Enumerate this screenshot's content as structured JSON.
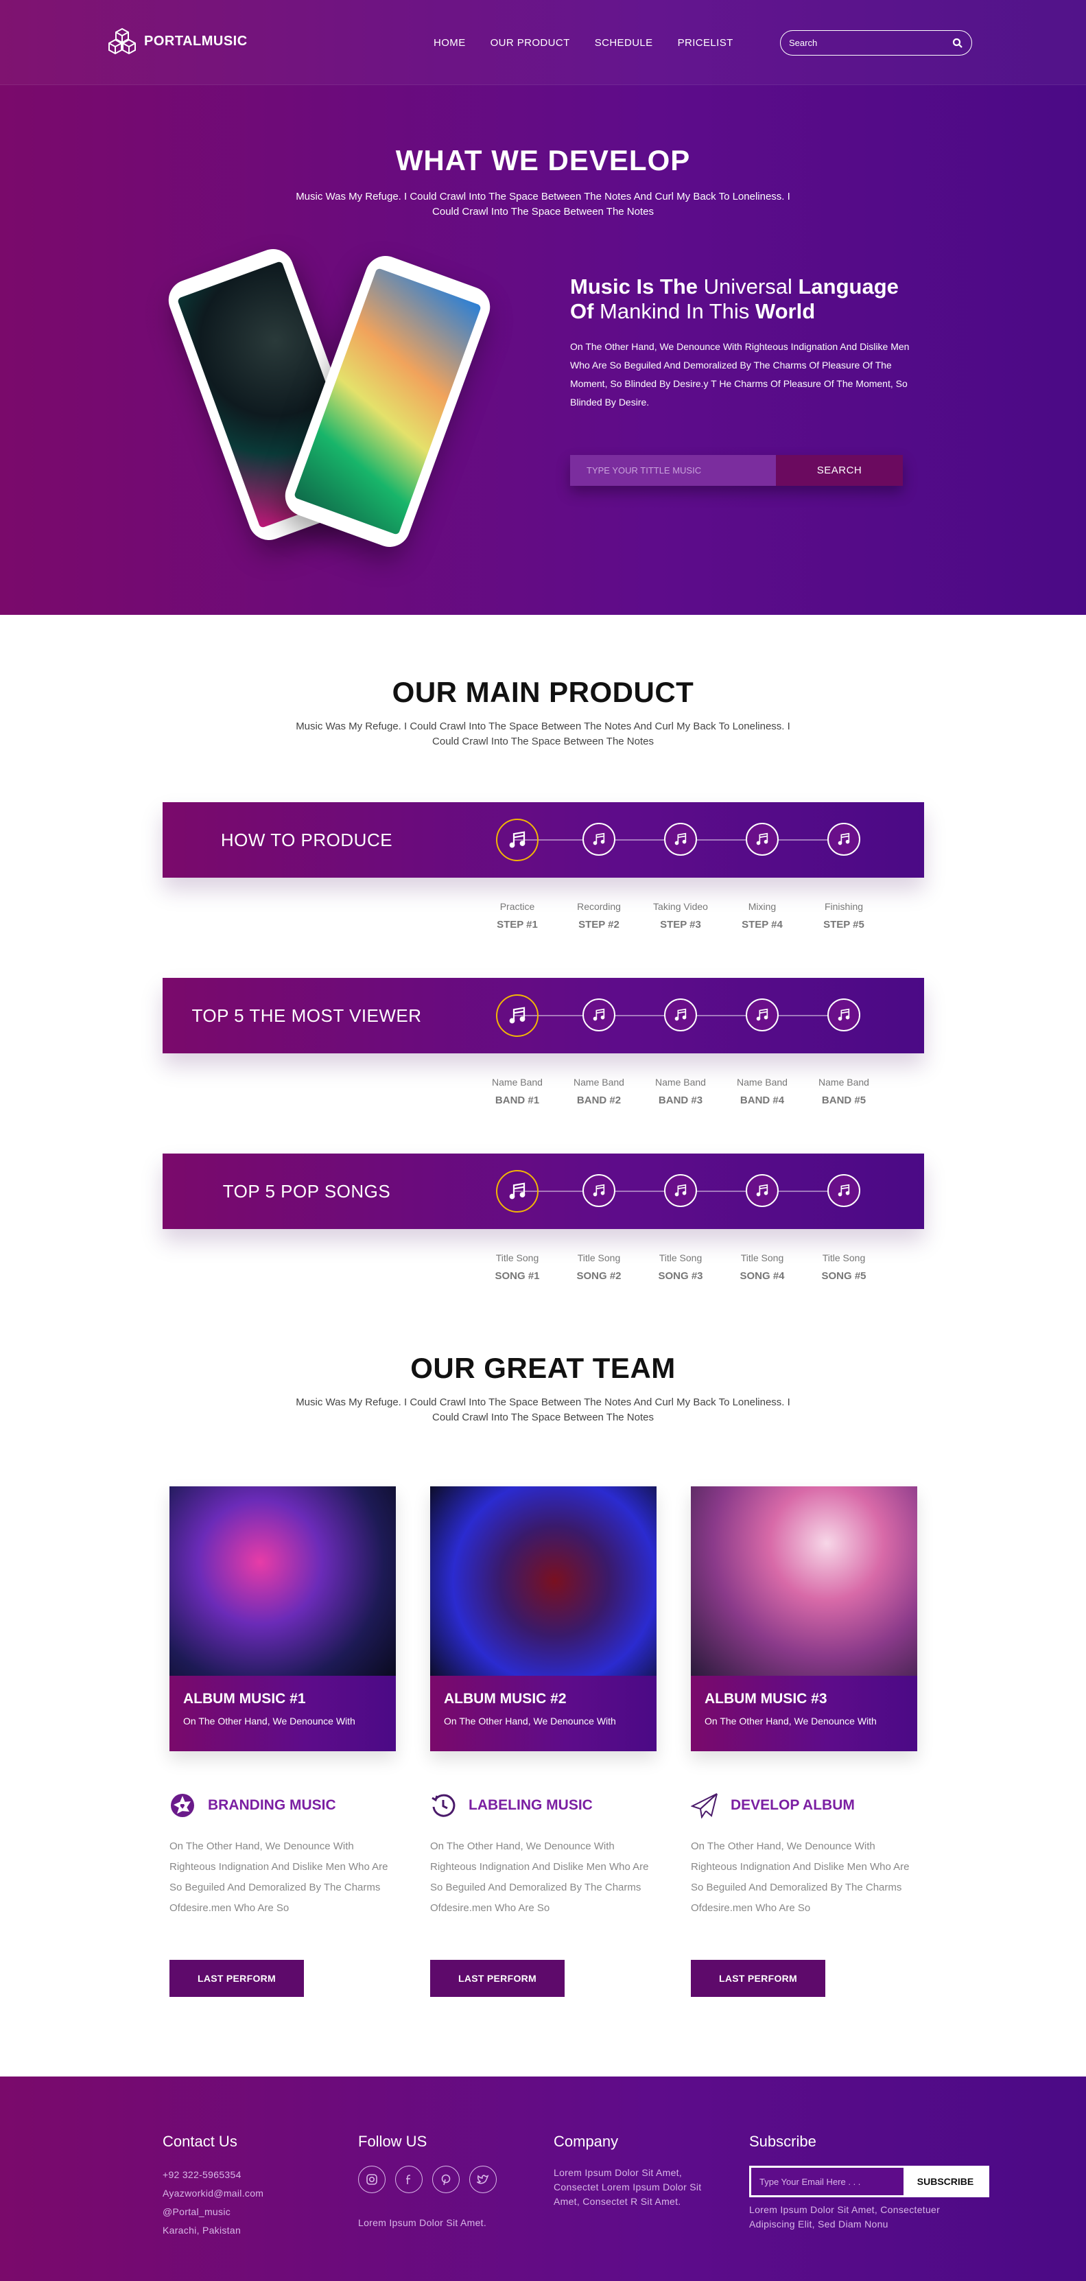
{
  "brand": {
    "name": "PORTALMUSIC"
  },
  "nav": [
    "HOME",
    "OUR PRODUCT",
    "SCHEDULE",
    "PRICELIST"
  ],
  "search": {
    "placeholder": "Search"
  },
  "hero": {
    "title": "WHAT WE DEVELOP",
    "subtitle": "Music Was My Refuge. I Could Crawl Into The Space Between The Notes And Curl My Back To Loneliness. I Could Crawl Into The Space Between The Notes",
    "headline_1": "Music Is The",
    "headline_2": " Universal ",
    "headline_3": "Language Of",
    "headline_4": " Mankind In This ",
    "headline_5": "World",
    "paragraph": "On The Other Hand, We Denounce With Righteous Indignation And Dislike Men Who Are So Beguiled And Demoralized By The Charms Of Pleasure Of The Moment, So Blinded By Desire.y T He Charms Of Pleasure Of The Moment, So Blinded By Desire.",
    "input_placeholder": "TYPE YOUR TITTLE MUSIC",
    "search_button": "SEARCH"
  },
  "product": {
    "title": "OUR MAIN PRODUCT",
    "subtitle": "Music Was My Refuge. I Could Crawl Into The Space Between The Notes And Curl My Back To Loneliness. I Could Crawl Into The Space Between The Notes",
    "rows": [
      {
        "label": "HOW TO PRODUCE",
        "steps": [
          {
            "a": "Practice",
            "b": "STEP #1"
          },
          {
            "a": "Recording",
            "b": "STEP #2"
          },
          {
            "a": "Taking Video",
            "b": "STEP #3"
          },
          {
            "a": "Mixing",
            "b": "STEP #4"
          },
          {
            "a": "Finishing",
            "b": "STEP #5"
          }
        ]
      },
      {
        "label": "TOP 5 THE MOST VIEWER",
        "steps": [
          {
            "a": "Name Band",
            "b": "BAND #1"
          },
          {
            "a": "Name Band",
            "b": "BAND #2"
          },
          {
            "a": "Name Band",
            "b": "BAND #3"
          },
          {
            "a": "Name Band",
            "b": "BAND #4"
          },
          {
            "a": "Name Band",
            "b": "BAND #5"
          }
        ]
      },
      {
        "label": "TOP 5 POP SONGS",
        "steps": [
          {
            "a": "Title Song",
            "b": "SONG #1"
          },
          {
            "a": "Title Song",
            "b": "SONG #2"
          },
          {
            "a": "Title Song",
            "b": "SONG #3"
          },
          {
            "a": "Title Song",
            "b": "SONG #4"
          },
          {
            "a": "Title Song",
            "b": "SONG #5"
          }
        ]
      }
    ]
  },
  "team": {
    "title": "OUR GREAT TEAM",
    "subtitle": "Music Was My Refuge. I Could Crawl Into The Space Between The Notes And Curl My Back To Loneliness. I Could Crawl Into The Space Between The Notes",
    "cards": [
      {
        "title": "ALBUM MUSIC #1",
        "text": "On The Other Hand, We Denounce With"
      },
      {
        "title": "ALBUM MUSIC #2",
        "text": "On The Other Hand, We Denounce With"
      },
      {
        "title": "ALBUM MUSIC #3",
        "text": "On The Other Hand, We Denounce With"
      }
    ],
    "features": [
      {
        "title": "BRANDING MUSIC",
        "icon": "aperture-icon",
        "text": "On The Other Hand, We Denounce With Righteous Indignation And Dislike Men Who Are So Beguiled And Demoralized By The Charms Ofdesire.men Who Are So",
        "button": "LAST PERFORM"
      },
      {
        "title": "LABELING MUSIC",
        "icon": "history-icon",
        "text": "On The Other Hand, We Denounce With Righteous Indignation And Dislike Men Who Are So Beguiled And Demoralized By The Charms Ofdesire.men Who Are So",
        "button": "LAST PERFORM"
      },
      {
        "title": "DEVELOP ALBUM",
        "icon": "paper-plane-icon",
        "text": "On The Other Hand, We Denounce With Righteous Indignation And Dislike Men Who Are So Beguiled And Demoralized By The Charms Ofdesire.men Who Are So",
        "button": "LAST PERFORM"
      }
    ]
  },
  "footer": {
    "contact": {
      "title": "Contact Us",
      "phone": "+92 322-5965354",
      "email": "Ayazworkid@mail.com",
      "handle": "@Portal_music",
      "city": "Karachi, Pakistan"
    },
    "follow": {
      "title": "Follow US",
      "text": "Lorem Ipsum Dolor Sit Amet."
    },
    "company": {
      "title": "Company",
      "text": "Lorem Ipsum Dolor Sit Amet, Consectet Lorem Ipsum Dolor Sit Amet, Consectet R Sit Amet."
    },
    "subscribe": {
      "title": "Subscribe",
      "placeholder": "Type Your Email Here . . .",
      "button": "SUBSCRIBE",
      "text": "Lorem Ipsum Dolor Sit Amet, Consectetuer Adipiscing Elit, Sed Diam Nonu"
    }
  },
  "colors": {
    "primary": "#7a0a6b",
    "secondary": "#4b0a86",
    "accent": "#f2b705",
    "feature_title": "#7b1fa2"
  }
}
